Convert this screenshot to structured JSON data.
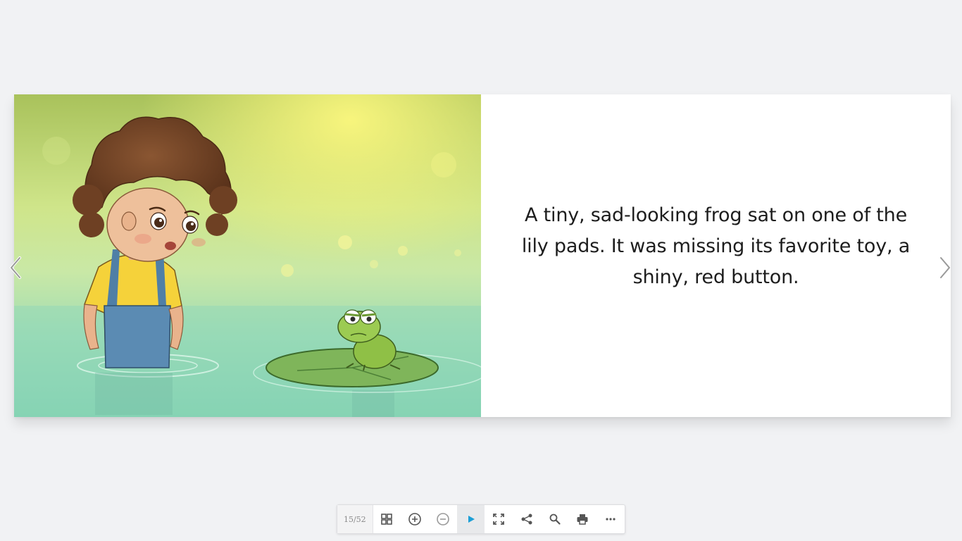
{
  "viewer": {
    "page_counter": "15/52",
    "story_text": "A tiny, sad-looking frog sat on one of the lily pads. It was missing its favorite toy, a shiny, red button."
  },
  "icons": {
    "prev": "chevron-left-icon",
    "next": "chevron-right-icon",
    "thumbnails": "grid-icon",
    "zoom_in": "plus-circle-icon",
    "zoom_out": "minus-circle-icon",
    "autoplay": "play-icon",
    "fullscreen": "fullscreen-icon",
    "share": "share-icon",
    "search": "search-icon",
    "print": "printer-icon",
    "more": "more-dots-icon"
  },
  "colors": {
    "background": "#f1f2f4",
    "play_accent": "#1d9fd6",
    "icon": "#555555"
  }
}
